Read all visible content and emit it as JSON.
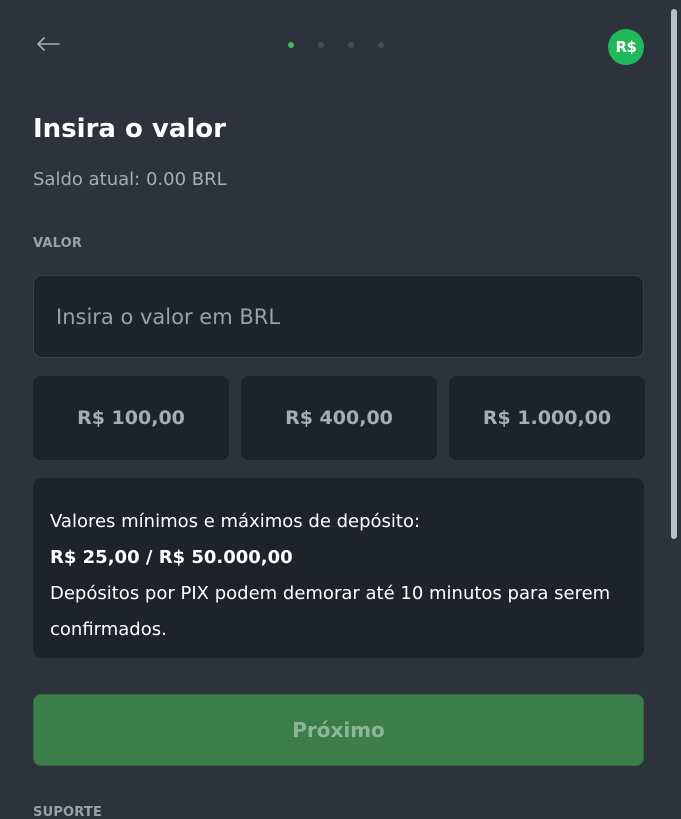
{
  "header": {
    "back_icon": "arrow-left-icon",
    "steps": {
      "total": 4,
      "current": 1
    },
    "currency_badge": "R$",
    "accent_color": "#3dbb65"
  },
  "main": {
    "title": "Insira o valor",
    "balance_label": "Saldo atual:",
    "balance_value": "0.00 BRL",
    "amount_field": {
      "label": "VALOR",
      "value": "",
      "placeholder": "Insira o valor em BRL"
    },
    "presets": [
      {
        "label": "R$ 100,00"
      },
      {
        "label": "R$ 400,00"
      },
      {
        "label": "R$ 1.000,00"
      }
    ],
    "info": {
      "heading": "Valores mínimos e máximos de depósito:",
      "limits": "R$ 25,00 / R$ 50.000,00",
      "note": "Depósitos por PIX podem demorar até 10 minutos para serem confirmados."
    },
    "next_button": "Próximo",
    "support_label": "SUPORTE"
  }
}
